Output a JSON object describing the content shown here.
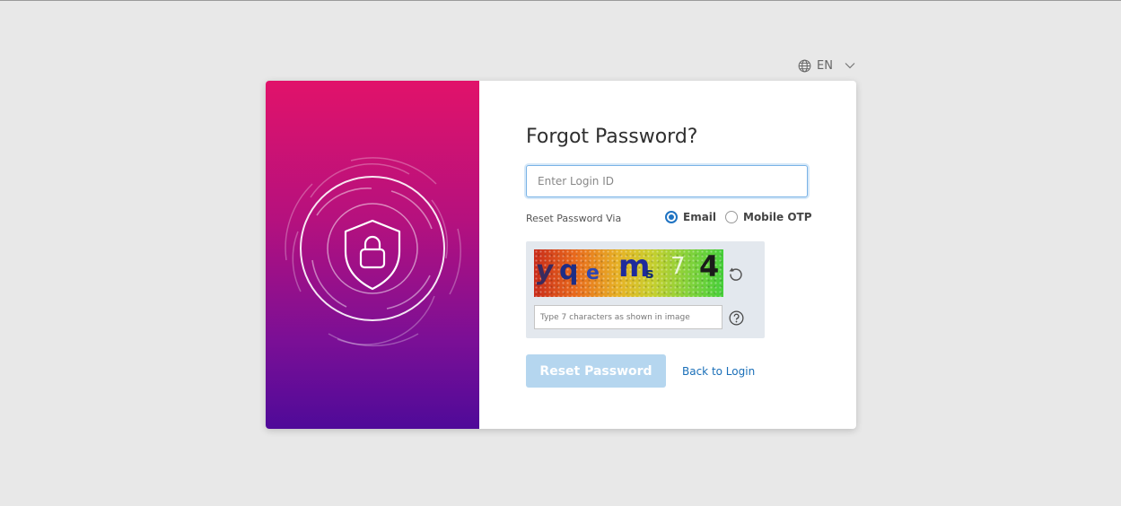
{
  "language": {
    "label": "EN",
    "icon": "globe-icon",
    "caret": "chevron-down-icon"
  },
  "form": {
    "title": "Forgot Password?",
    "login_placeholder": "Enter Login ID",
    "reset_via_label": "Reset Password Via",
    "options": [
      {
        "label": "Email",
        "selected": true
      },
      {
        "label": "Mobile OTP",
        "selected": false
      }
    ],
    "captcha": {
      "chars": [
        "y",
        "q",
        "e",
        "m",
        "s",
        "7",
        "4"
      ],
      "input_placeholder": "Type 7 characters as shown in image",
      "refresh_icon": "refresh-icon",
      "help_icon": "help-icon"
    },
    "submit_label": "Reset Password",
    "back_link": "Back to Login"
  },
  "colors": {
    "brand_gradient_top": "#e1126a",
    "brand_gradient_bottom": "#4f0a99",
    "accent": "#1f73c2",
    "button_disabled": "#b5d6ef",
    "link": "#1a6fb8",
    "background": "#e8e8e8"
  }
}
